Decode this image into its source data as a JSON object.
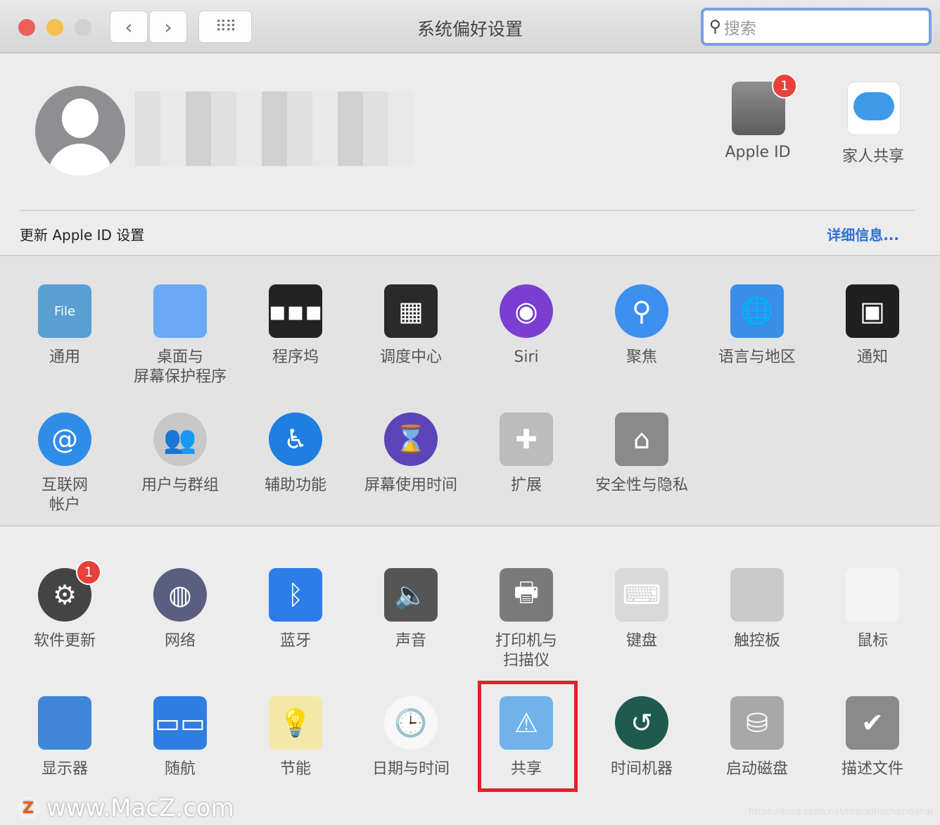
{
  "window": {
    "title": "系统偏好设置",
    "search_placeholder": "搜索",
    "traffic_lights": {
      "close": "#ec5f57",
      "minimize": "#f5bf4f",
      "zoom": "#cfcfcf"
    }
  },
  "account": {
    "apple_id_label": "Apple ID",
    "apple_id_badge": "1",
    "family_label": "家人共享",
    "update_text": "更新 Apple ID 设置",
    "details_link": "详细信息..."
  },
  "section1": [
    {
      "label": "通用",
      "icon": "general-icon",
      "color": "#5a9fd4",
      "glyph": "File"
    },
    {
      "label": "桌面与\n屏幕保护程序",
      "icon": "desktop-screensaver-icon",
      "color": "#6aa9f5",
      "glyph": ""
    },
    {
      "label": "程序坞",
      "icon": "dock-icon",
      "color": "#222",
      "glyph": "▪▪▪"
    },
    {
      "label": "调度中心",
      "icon": "mission-control-icon",
      "color": "#2a2a2a",
      "glyph": "▦"
    },
    {
      "label": "Siri",
      "icon": "siri-icon",
      "color": "#7a3fd0",
      "glyph": "◉"
    },
    {
      "label": "聚焦",
      "icon": "spotlight-icon",
      "color": "#3d8ff0",
      "glyph": "⚲"
    },
    {
      "label": "语言与地区",
      "icon": "language-region-icon",
      "color": "#3a8ee8",
      "glyph": "🌐"
    },
    {
      "label": "通知",
      "icon": "notifications-icon",
      "color": "#1f1f1f",
      "glyph": "▣"
    },
    {
      "label": "互联网\n帐户",
      "icon": "internet-accounts-icon",
      "color": "#2f8ce8",
      "glyph": "@"
    },
    {
      "label": "用户与群组",
      "icon": "users-groups-icon",
      "color": "#c8c8c8",
      "glyph": "👥"
    },
    {
      "label": "辅助功能",
      "icon": "accessibility-icon",
      "color": "#1f7fe0",
      "glyph": "♿"
    },
    {
      "label": "屏幕使用时间",
      "icon": "screen-time-icon",
      "color": "#5b45b8",
      "glyph": "⌛"
    },
    {
      "label": "扩展",
      "icon": "extensions-icon",
      "color": "#bcbcbc",
      "glyph": "✚"
    },
    {
      "label": "安全性与隐私",
      "icon": "security-privacy-icon",
      "color": "#8a8a8a",
      "glyph": "⌂"
    }
  ],
  "section2": [
    {
      "label": "软件更新",
      "icon": "software-update-icon",
      "color": "#444",
      "glyph": "⚙",
      "badge": "1"
    },
    {
      "label": "网络",
      "icon": "network-icon",
      "color": "#5a5f80",
      "glyph": "◍"
    },
    {
      "label": "蓝牙",
      "icon": "bluetooth-icon",
      "color": "#2d7de8",
      "glyph": "ᛒ"
    },
    {
      "label": "声音",
      "icon": "sound-icon",
      "color": "#555",
      "glyph": "🔈"
    },
    {
      "label": "打印机与\n扫描仪",
      "icon": "printers-scanners-icon",
      "color": "#7a7a7a",
      "glyph": "🖶"
    },
    {
      "label": "键盘",
      "icon": "keyboard-icon",
      "color": "#d9d9d9",
      "glyph": "⌨"
    },
    {
      "label": "触控板",
      "icon": "trackpad-icon",
      "color": "#c9c9c9",
      "glyph": ""
    },
    {
      "label": "鼠标",
      "icon": "mouse-icon",
      "color": "#f4f4f4",
      "glyph": ""
    },
    {
      "label": "显示器",
      "icon": "displays-icon",
      "color": "#3f86d8",
      "glyph": ""
    },
    {
      "label": "随航",
      "icon": "sidecar-icon",
      "color": "#2f7de0",
      "glyph": "▭▭"
    },
    {
      "label": "节能",
      "icon": "energy-saver-icon",
      "color": "#f3e8a8",
      "glyph": "💡"
    },
    {
      "label": "日期与时间",
      "icon": "date-time-icon",
      "color": "#f7f7f7",
      "glyph": "🕒"
    },
    {
      "label": "共享",
      "icon": "sharing-icon",
      "color": "#6fb3ea",
      "glyph": "⚠"
    },
    {
      "label": "时间机器",
      "icon": "time-machine-icon",
      "color": "#1e5a4e",
      "glyph": "↺"
    },
    {
      "label": "启动磁盘",
      "icon": "startup-disk-icon",
      "color": "#a8a8a8",
      "glyph": "⛁"
    },
    {
      "label": "描述文件",
      "icon": "profiles-icon",
      "color": "#8a8a8a",
      "glyph": "✔"
    }
  ],
  "watermark": {
    "text": "www.MacZ.com",
    "source": "https://blog.csdn.net/macxingchendahai"
  }
}
